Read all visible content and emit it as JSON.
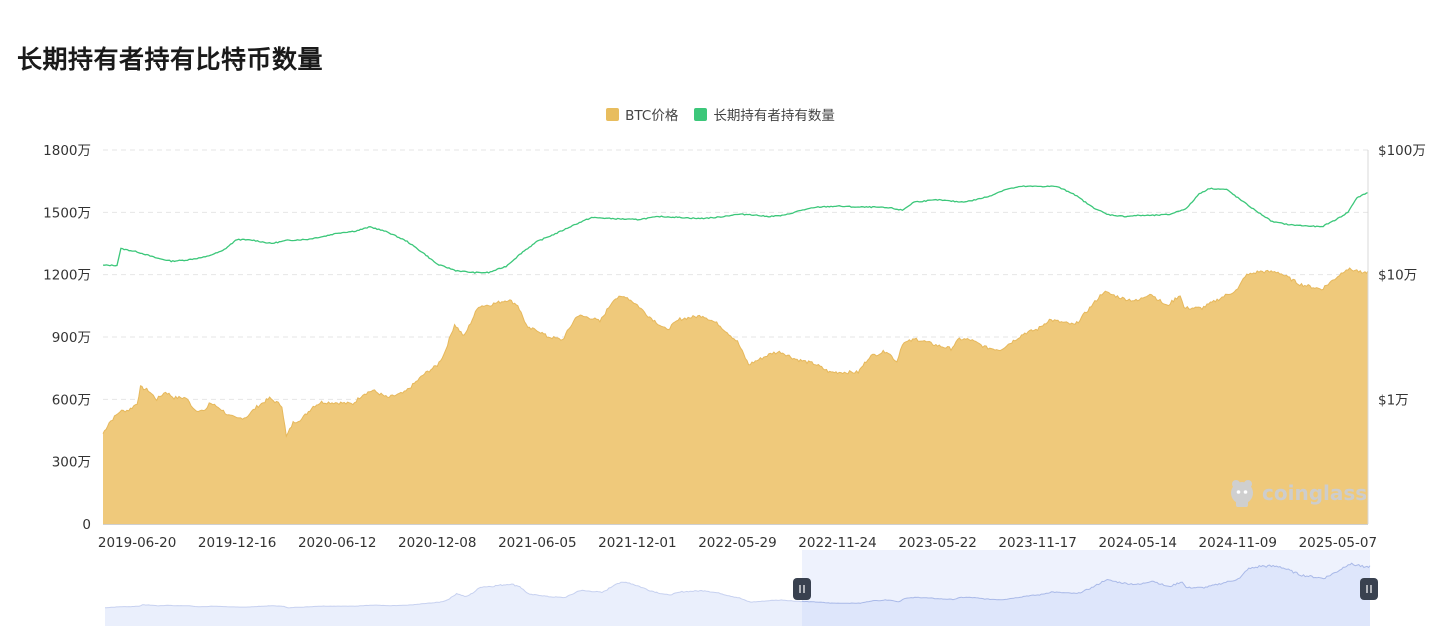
{
  "title": "长期持有者持有比特币数量",
  "colors": {
    "price_fill": "#efc97b",
    "price_line": "#e6b85c",
    "holdings_line": "#3cc77a",
    "grid": "#e6e6e6",
    "slider_fill": "#dbe4fb",
    "slider_line": "#a9b9e8",
    "handle": "#39414f"
  },
  "legend": [
    {
      "label": "BTC价格",
      "color": "#e8bd5e"
    },
    {
      "label": "长期持有者持有数量",
      "color": "#3cc77a"
    }
  ],
  "watermark": "coinglass",
  "chart_data": {
    "type": "area",
    "x_ticks": [
      "2019-06-20",
      "2019-12-16",
      "2020-06-12",
      "2020-12-08",
      "2021-06-05",
      "2021-12-01",
      "2022-05-29",
      "2022-11-24",
      "2023-05-22",
      "2023-11-17",
      "2024-05-14",
      "2024-11-09",
      "2025-05-07"
    ],
    "y_left_ticks": [
      "0",
      "300万",
      "600万",
      "900万",
      "1200万",
      "1500万",
      "1800万"
    ],
    "y_left_range": [
      0,
      18000000
    ],
    "y_right_ticks": [
      "$1万",
      "$10万",
      "$100万"
    ],
    "y_right_scale": "log",
    "y_right_range": [
      1000,
      1000000
    ],
    "grid": true,
    "legend_position": "top-center",
    "series": [
      {
        "name": "BTC价格",
        "axis": "right",
        "style": "area",
        "points": [
          [
            "2019-04-20",
            5300
          ],
          [
            "2019-05-01",
            6500
          ],
          [
            "2019-05-20",
            8000
          ],
          [
            "2019-06-05",
            8200
          ],
          [
            "2019-06-20",
            9300
          ],
          [
            "2019-06-26",
            12500
          ],
          [
            "2019-07-10",
            11800
          ],
          [
            "2019-07-25",
            10000
          ],
          [
            "2019-08-10",
            11500
          ],
          [
            "2019-08-25",
            10300
          ],
          [
            "2019-09-15",
            10300
          ],
          [
            "2019-10-01",
            8300
          ],
          [
            "2019-10-20",
            8000
          ],
          [
            "2019-10-27",
            9400
          ],
          [
            "2019-11-15",
            8500
          ],
          [
            "2019-12-01",
            7400
          ],
          [
            "2019-12-16",
            7000
          ],
          [
            "2020-01-01",
            7200
          ],
          [
            "2020-01-20",
            8700
          ],
          [
            "2020-02-12",
            10200
          ],
          [
            "2020-03-05",
            8900
          ],
          [
            "2020-03-13",
            5000
          ],
          [
            "2020-03-25",
            6500
          ],
          [
            "2020-04-10",
            7000
          ],
          [
            "2020-04-30",
            8800
          ],
          [
            "2020-05-15",
            9500
          ],
          [
            "2020-06-12",
            9400
          ],
          [
            "2020-07-10",
            9200
          ],
          [
            "2020-07-28",
            11000
          ],
          [
            "2020-08-15",
            11800
          ],
          [
            "2020-09-10",
            10300
          ],
          [
            "2020-10-10",
            11300
          ],
          [
            "2020-10-25",
            13000
          ],
          [
            "2020-11-15",
            16000
          ],
          [
            "2020-12-08",
            18800
          ],
          [
            "2020-12-20",
            23000
          ],
          [
            "2021-01-08",
            40000
          ],
          [
            "2021-01-25",
            32000
          ],
          [
            "2021-02-20",
            56000
          ],
          [
            "2021-03-10",
            57000
          ],
          [
            "2021-04-14",
            63000
          ],
          [
            "2021-05-01",
            57000
          ],
          [
            "2021-05-19",
            37000
          ],
          [
            "2021-06-05",
            36000
          ],
          [
            "2021-06-22",
            32000
          ],
          [
            "2021-07-20",
            30000
          ],
          [
            "2021-08-15",
            47000
          ],
          [
            "2021-09-10",
            45000
          ],
          [
            "2021-09-25",
            42000
          ],
          [
            "2021-10-20",
            64000
          ],
          [
            "2021-11-10",
            67000
          ],
          [
            "2021-12-01",
            57000
          ],
          [
            "2021-12-20",
            47000
          ],
          [
            "2022-01-22",
            36000
          ],
          [
            "2022-02-15",
            44000
          ],
          [
            "2022-03-28",
            47000
          ],
          [
            "2022-04-25",
            40000
          ],
          [
            "2022-05-29",
            29000
          ],
          [
            "2022-06-18",
            19000
          ],
          [
            "2022-07-30",
            23500
          ],
          [
            "2022-08-15",
            24000
          ],
          [
            "2022-09-10",
            21000
          ],
          [
            "2022-10-15",
            19200
          ],
          [
            "2022-11-10",
            16500
          ],
          [
            "2022-11-24",
            16500
          ],
          [
            "2022-12-31",
            16500
          ],
          [
            "2023-01-20",
            22000
          ],
          [
            "2023-02-20",
            24500
          ],
          [
            "2023-03-10",
            20000
          ],
          [
            "2023-03-20",
            28000
          ],
          [
            "2023-04-14",
            30500
          ],
          [
            "2023-05-22",
            27000
          ],
          [
            "2023-06-15",
            25500
          ],
          [
            "2023-06-30",
            30500
          ],
          [
            "2023-07-20",
            30000
          ],
          [
            "2023-08-17",
            26000
          ],
          [
            "2023-09-11",
            25000
          ],
          [
            "2023-10-25",
            34000
          ],
          [
            "2023-11-17",
            36500
          ],
          [
            "2023-12-08",
            43500
          ],
          [
            "2024-01-23",
            39500
          ],
          [
            "2024-02-15",
            52000
          ],
          [
            "2024-03-14",
            73000
          ],
          [
            "2024-04-20",
            64000
          ],
          [
            "2024-05-14",
            61500
          ],
          [
            "2024-06-05",
            71000
          ],
          [
            "2024-07-05",
            56000
          ],
          [
            "2024-07-29",
            69000
          ],
          [
            "2024-08-05",
            54000
          ],
          [
            "2024-09-06",
            54000
          ],
          [
            "2024-10-15",
            67000
          ],
          [
            "2024-11-09",
            76000
          ],
          [
            "2024-11-22",
            98000
          ],
          [
            "2024-12-17",
            106000
          ],
          [
            "2025-01-20",
            105000
          ],
          [
            "2025-02-28",
            84000
          ],
          [
            "2025-04-08",
            76500
          ],
          [
            "2025-05-07",
            97000
          ],
          [
            "2025-05-22",
            111000
          ],
          [
            "2025-06-10",
            108000
          ],
          [
            "2025-06-22",
            101000
          ],
          [
            "2025-06-30",
            107000
          ]
        ]
      },
      {
        "name": "长期持有者持有数量",
        "axis": "left",
        "style": "line",
        "points": [
          [
            "2019-04-20",
            12450000
          ],
          [
            "2019-05-15",
            12450000
          ],
          [
            "2019-05-22",
            13250000
          ],
          [
            "2019-06-20",
            13100000
          ],
          [
            "2019-07-25",
            12800000
          ],
          [
            "2019-08-20",
            12650000
          ],
          [
            "2019-09-15",
            12700000
          ],
          [
            "2019-10-20",
            12850000
          ],
          [
            "2019-11-20",
            13150000
          ],
          [
            "2019-12-16",
            13700000
          ],
          [
            "2020-01-15",
            13650000
          ],
          [
            "2020-02-15",
            13500000
          ],
          [
            "2020-03-15",
            13650000
          ],
          [
            "2020-04-20",
            13700000
          ],
          [
            "2020-05-20",
            13850000
          ],
          [
            "2020-06-12",
            14000000
          ],
          [
            "2020-07-15",
            14100000
          ],
          [
            "2020-08-10",
            14300000
          ],
          [
            "2020-09-10",
            14050000
          ],
          [
            "2020-10-15",
            13600000
          ],
          [
            "2020-11-15",
            13000000
          ],
          [
            "2020-12-08",
            12500000
          ],
          [
            "2021-01-10",
            12200000
          ],
          [
            "2021-02-10",
            12100000
          ],
          [
            "2021-03-10",
            12100000
          ],
          [
            "2021-04-10",
            12400000
          ],
          [
            "2021-05-10",
            13100000
          ],
          [
            "2021-06-05",
            13600000
          ],
          [
            "2021-07-10",
            14000000
          ],
          [
            "2021-08-10",
            14400000
          ],
          [
            "2021-09-10",
            14750000
          ],
          [
            "2021-10-15",
            14700000
          ],
          [
            "2021-12-01",
            14650000
          ],
          [
            "2022-01-10",
            14800000
          ],
          [
            "2022-02-20",
            14750000
          ],
          [
            "2022-03-20",
            14700000
          ],
          [
            "2022-04-20",
            14750000
          ],
          [
            "2022-05-29",
            14900000
          ],
          [
            "2022-06-20",
            14900000
          ],
          [
            "2022-07-20",
            14800000
          ],
          [
            "2022-08-20",
            14850000
          ],
          [
            "2022-09-20",
            15100000
          ],
          [
            "2022-10-20",
            15250000
          ],
          [
            "2022-11-24",
            15300000
          ],
          [
            "2022-12-31",
            15250000
          ],
          [
            "2023-02-01",
            15250000
          ],
          [
            "2023-03-01",
            15200000
          ],
          [
            "2023-03-20",
            15100000
          ],
          [
            "2023-04-10",
            15500000
          ],
          [
            "2023-05-22",
            15600000
          ],
          [
            "2023-07-01",
            15500000
          ],
          [
            "2023-07-20",
            15550000
          ],
          [
            "2023-08-20",
            15750000
          ],
          [
            "2023-09-20",
            16100000
          ],
          [
            "2023-10-20",
            16250000
          ],
          [
            "2023-11-17",
            16250000
          ],
          [
            "2023-12-20",
            16250000
          ],
          [
            "2024-01-20",
            15900000
          ],
          [
            "2024-02-20",
            15300000
          ],
          [
            "2024-03-20",
            14900000
          ],
          [
            "2024-04-20",
            14800000
          ],
          [
            "2024-05-14",
            14850000
          ],
          [
            "2024-06-10",
            14850000
          ],
          [
            "2024-07-10",
            14900000
          ],
          [
            "2024-08-10",
            15200000
          ],
          [
            "2024-09-01",
            15900000
          ],
          [
            "2024-09-20",
            16150000
          ],
          [
            "2024-10-20",
            16100000
          ],
          [
            "2024-11-09",
            15700000
          ],
          [
            "2024-12-10",
            15100000
          ],
          [
            "2025-01-10",
            14550000
          ],
          [
            "2025-02-10",
            14400000
          ],
          [
            "2025-03-10",
            14350000
          ],
          [
            "2025-04-08",
            14300000
          ],
          [
            "2025-05-07",
            14700000
          ],
          [
            "2025-05-25",
            15000000
          ],
          [
            "2025-06-10",
            15700000
          ],
          [
            "2025-06-30",
            15950000
          ]
        ]
      }
    ]
  }
}
